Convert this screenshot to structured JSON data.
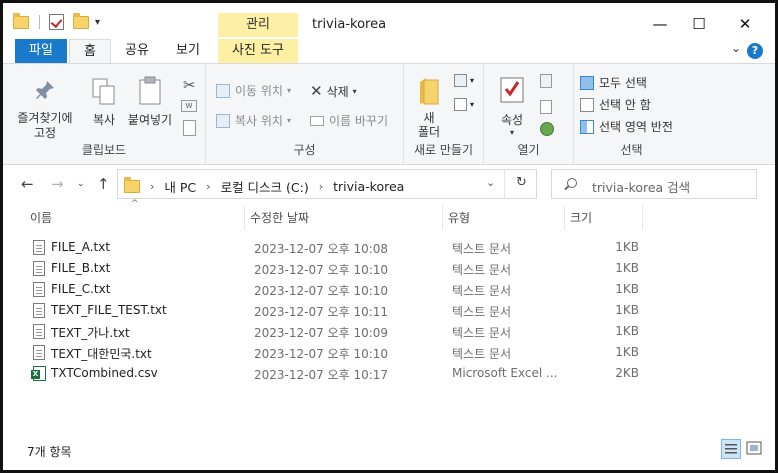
{
  "window": {
    "title": "trivia-korea",
    "context_tab": "관리",
    "controls": {
      "minimize": "—",
      "maximize": "☐",
      "close": "✕"
    }
  },
  "tabs": {
    "file": "파일",
    "home": "홈",
    "share": "공유",
    "view": "보기",
    "picture_tools": "사진 도구"
  },
  "ribbon": {
    "clipboard": {
      "label": "클립보드",
      "pin": "즐겨찾기에 고정",
      "pin_line1": "즐겨찾기에",
      "pin_line2": "고정",
      "copy": "복사",
      "paste": "붙여넣기"
    },
    "organize": {
      "label": "구성",
      "move_to": "이동 위치",
      "copy_to": "복사 위치",
      "delete": "삭제",
      "rename": "이름 바꾸기"
    },
    "new": {
      "label": "새로 만들기",
      "new_folder_line1": "새",
      "new_folder_line2": "폴더"
    },
    "open": {
      "label": "열기",
      "properties": "속성"
    },
    "select": {
      "label": "선택",
      "select_all": "모두 선택",
      "select_none": "선택 안 함",
      "invert": "선택 영역 반전"
    }
  },
  "address": {
    "crumbs": [
      "내 PC",
      "로컬 디스크 (C:)",
      "trivia-korea"
    ],
    "search_placeholder": "trivia-korea 검색"
  },
  "columns": {
    "name": "이름",
    "date": "수정한 날짜",
    "type": "유형",
    "size": "크기"
  },
  "files": [
    {
      "name": "FILE_A.txt",
      "date": "2023-12-07 오후 10:08",
      "type": "텍스트 문서",
      "size": "1KB",
      "icon": "text-file-icon"
    },
    {
      "name": "FILE_B.txt",
      "date": "2023-12-07 오후 10:10",
      "type": "텍스트 문서",
      "size": "1KB",
      "icon": "text-file-icon"
    },
    {
      "name": "FILE_C.txt",
      "date": "2023-12-07 오후 10:10",
      "type": "텍스트 문서",
      "size": "1KB",
      "icon": "text-file-icon"
    },
    {
      "name": "TEXT_FILE_TEST.txt",
      "date": "2023-12-07 오후 10:11",
      "type": "텍스트 문서",
      "size": "1KB",
      "icon": "text-file-icon"
    },
    {
      "name": "TEXT_가나.txt",
      "date": "2023-12-07 오후 10:09",
      "type": "텍스트 문서",
      "size": "1KB",
      "icon": "text-file-icon"
    },
    {
      "name": "TEXT_대한민국.txt",
      "date": "2023-12-07 오후 10:10",
      "type": "텍스트 문서",
      "size": "1KB",
      "icon": "text-file-icon"
    },
    {
      "name": "TXTCombined.csv",
      "date": "2023-12-07 오후 10:17",
      "type": "Microsoft Excel ...",
      "size": "2KB",
      "icon": "excel-csv-icon"
    }
  ],
  "status": {
    "item_count": "7개 항목"
  },
  "colors": {
    "accent": "#1979ca",
    "context_tab": "#fdf0a4",
    "ribbon_bg": "#f5f6f7"
  }
}
